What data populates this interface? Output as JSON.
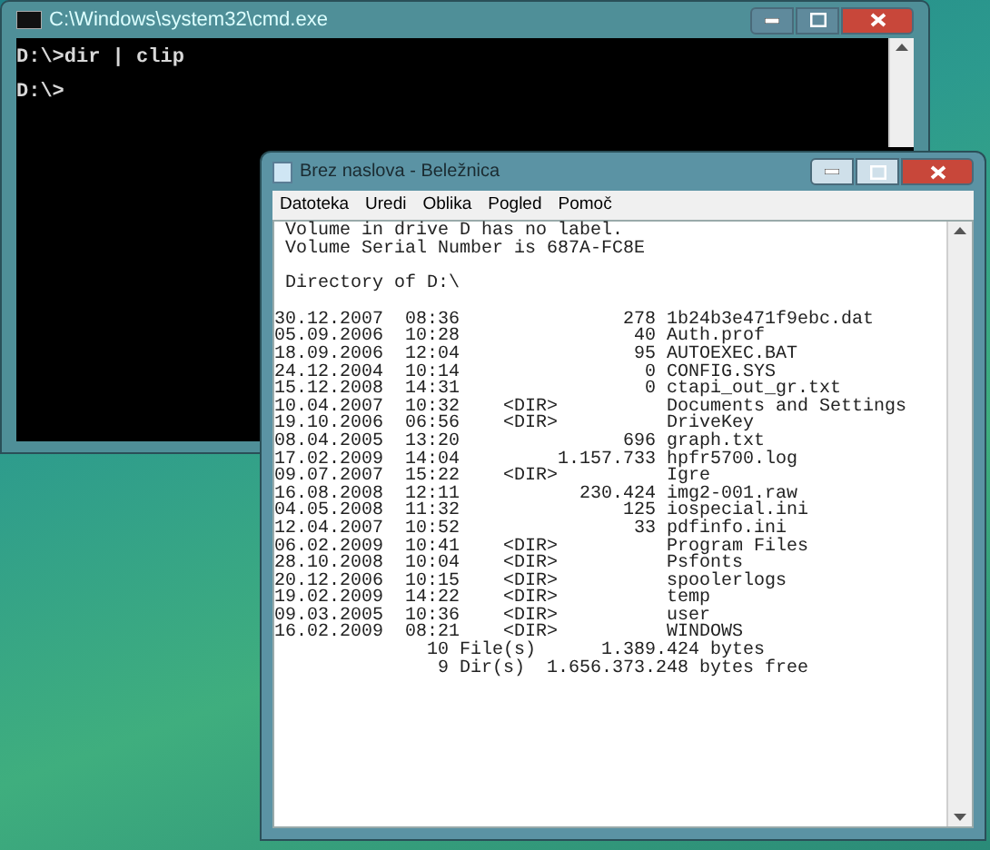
{
  "console_window": {
    "title": "C:\\Windows\\system32\\cmd.exe",
    "lines": [
      "D:\\>dir | clip",
      "D:\\>"
    ]
  },
  "notepad_window": {
    "title": "Brez naslova - Beležnica",
    "menu": [
      "Datoteka",
      "Uredi",
      "Oblika",
      "Pogled",
      "Pomoč"
    ],
    "text_blocks": [
      [
        " Volume in drive D has no label.",
        " Volume Serial Number is 687A-FC8E"
      ],
      [
        " Directory of D:\\"
      ],
      [
        "30.12.2007  08:36               278 1b24b3e471f9ebc.dat",
        "05.09.2006  10:28                40 Auth.prof",
        "18.09.2006  12:04                95 AUTOEXEC.BAT",
        "24.12.2004  10:14                 0 CONFIG.SYS",
        "15.12.2008  14:31                 0 ctapi_out_gr.txt",
        "10.04.2007  10:32    <DIR>          Documents and Settings",
        "19.10.2006  06:56    <DIR>          DriveKey",
        "08.04.2005  13:20               696 graph.txt",
        "17.02.2009  14:04         1.157.733 hpfr5700.log",
        "09.07.2007  15:22    <DIR>          Igre",
        "16.08.2008  12:11           230.424 img2-001.raw",
        "04.05.2008  11:32               125 iospecial.ini",
        "12.04.2007  10:52                33 pdfinfo.ini",
        "06.02.2009  10:41    <DIR>          Program Files",
        "28.10.2008  10:04    <DIR>          Psfonts",
        "20.12.2006  10:15    <DIR>          spoolerlogs",
        "19.02.2009  14:22    <DIR>          temp",
        "09.03.2005  10:36    <DIR>          user",
        "16.02.2009  08:21    <DIR>          WINDOWS",
        "              10 File(s)      1.389.424 bytes",
        "               9 Dir(s)  1.656.373.248 bytes free"
      ]
    ]
  }
}
